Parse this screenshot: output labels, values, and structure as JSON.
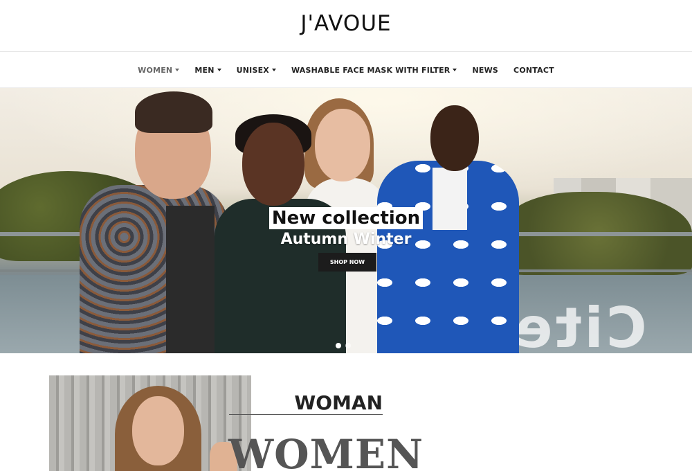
{
  "header": {
    "logo": "J'AVOUE"
  },
  "nav": {
    "items": [
      {
        "label": "WOMEN",
        "dropdown": true,
        "active": true
      },
      {
        "label": "MEN",
        "dropdown": true
      },
      {
        "label": "UNISEX",
        "dropdown": true
      },
      {
        "label": "WASHABLE FACE MASK WITH FILTER",
        "dropdown": true
      },
      {
        "label": "NEWS",
        "dropdown": false
      },
      {
        "label": "CONTACT",
        "dropdown": false
      }
    ]
  },
  "hero": {
    "title": "New collection",
    "subtitle": "Autumn Winter",
    "cta_label": "SHOP NOW",
    "glass_text": "Cite"
  },
  "section": {
    "heading": "WOMAN",
    "background_word": "WOMEN"
  },
  "colors": {
    "text": "#222222",
    "button": "#1c1c1c",
    "accent_blue": "#1f57b8"
  }
}
